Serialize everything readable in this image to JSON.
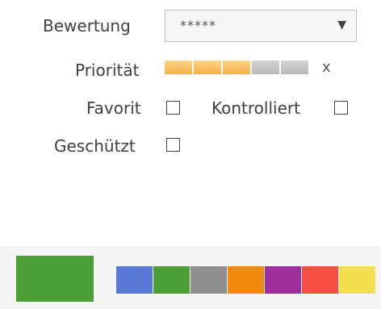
{
  "rating": {
    "label": "Bewertung",
    "value": "*****",
    "arrow_icon": "dropdown-arrow"
  },
  "priority": {
    "label": "Priorität",
    "level": 3,
    "max": 5,
    "clear": "x"
  },
  "flags": {
    "favorite": {
      "label": "Favorit",
      "checked": false
    },
    "checked": {
      "label": "Kontrolliert",
      "checked": false
    },
    "protected": {
      "label": "Geschützt",
      "checked": false
    }
  },
  "colors": {
    "selected": "#4c9e37",
    "palette": [
      "#5a79d7",
      "#4c9e37",
      "#8f8f8f",
      "#f28a10",
      "#9e2f9c",
      "#f74f44",
      "#f3e04e"
    ]
  }
}
